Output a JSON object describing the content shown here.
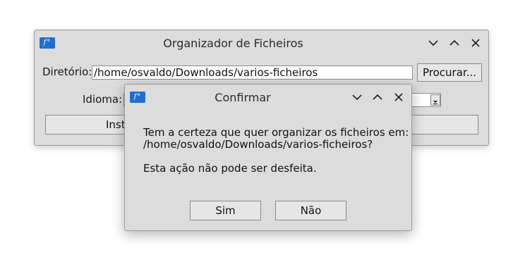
{
  "main_window": {
    "title": "Organizador de Ficheiros",
    "icon": "app-f-icon",
    "directory_label": "Diretório:",
    "directory_value": "/home/osvaldo/Downloads/varios-ficheiros",
    "browse_label": "Procurar...",
    "language_label": "Idioma:",
    "instructions_label": "Instr"
  },
  "dialog": {
    "title": "Confirmar",
    "icon": "app-f-icon",
    "message_line1": "Tem a certeza que quer organizar os ficheiros em:",
    "message_line2": "/home/osvaldo/Downloads/varios-ficheiros?",
    "warning": "Esta ação não pode ser desfeita.",
    "yes_label": "Sim",
    "no_label": "Não"
  },
  "window_controls": [
    "minimize-icon",
    "maximize-icon",
    "close-icon"
  ],
  "colors": {
    "window_bg": "#dcdcdc",
    "icon_blue": "#1e6fd0",
    "entry_bg": "#ffffff"
  }
}
